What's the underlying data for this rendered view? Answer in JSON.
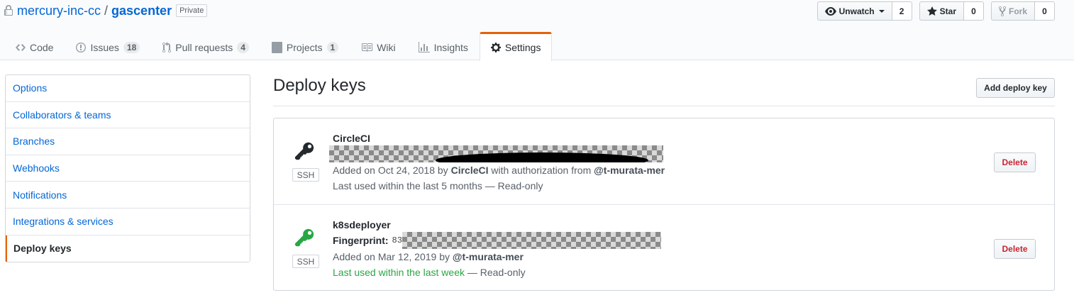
{
  "repo": {
    "owner": "mercury-inc-cc",
    "separator": "/",
    "name": "gascenter",
    "visibility": "Private"
  },
  "actions": {
    "watch": {
      "label": "Unwatch",
      "count": "2"
    },
    "star": {
      "label": "Star",
      "count": "0"
    },
    "fork": {
      "label": "Fork",
      "count": "0"
    }
  },
  "tabs": [
    {
      "label": "Code",
      "icon": "code-icon"
    },
    {
      "label": "Issues",
      "icon": "issue-icon",
      "count": "18"
    },
    {
      "label": "Pull requests",
      "icon": "pull-request-icon",
      "count": "4"
    },
    {
      "label": "Projects",
      "icon": "project-icon",
      "count": "1"
    },
    {
      "label": "Wiki",
      "icon": "book-icon"
    },
    {
      "label": "Insights",
      "icon": "graph-icon"
    },
    {
      "label": "Settings",
      "icon": "gear-icon",
      "selected": true
    }
  ],
  "sidebar": {
    "items": [
      {
        "label": "Options"
      },
      {
        "label": "Collaborators & teams"
      },
      {
        "label": "Branches"
      },
      {
        "label": "Webhooks"
      },
      {
        "label": "Notifications"
      },
      {
        "label": "Integrations & services"
      },
      {
        "label": "Deploy keys",
        "selected": true
      }
    ]
  },
  "main": {
    "title": "Deploy keys",
    "add_button": "Add deploy key",
    "keys": [
      {
        "title": "CircleCI",
        "type": "SSH",
        "key_color": "#24292e",
        "added_prefix": "Added on Oct 24, 2018 by ",
        "added_by": "CircleCI",
        "added_mid": " with authorization from ",
        "authorized_by": "@t-murata-mer",
        "last_used_recent": "",
        "last_used": "Last used within the last 5 months — Read-only",
        "delete_label": "Delete"
      },
      {
        "title": "k8sdeployer",
        "type": "SSH",
        "key_color": "#28a745",
        "fingerprint_label": "Fingerprint:",
        "fingerprint_visible": "83",
        "added_prefix": "Added on Mar 12, 2019 by ",
        "added_by": "@t-murata-mer",
        "last_used_recent": "Last used within the last week",
        "last_used": " — Read-only",
        "delete_label": "Delete"
      }
    ]
  },
  "colors": {
    "accent": "#e36209",
    "link": "#0366d6",
    "danger": "#cb2431",
    "success": "#28a745"
  }
}
